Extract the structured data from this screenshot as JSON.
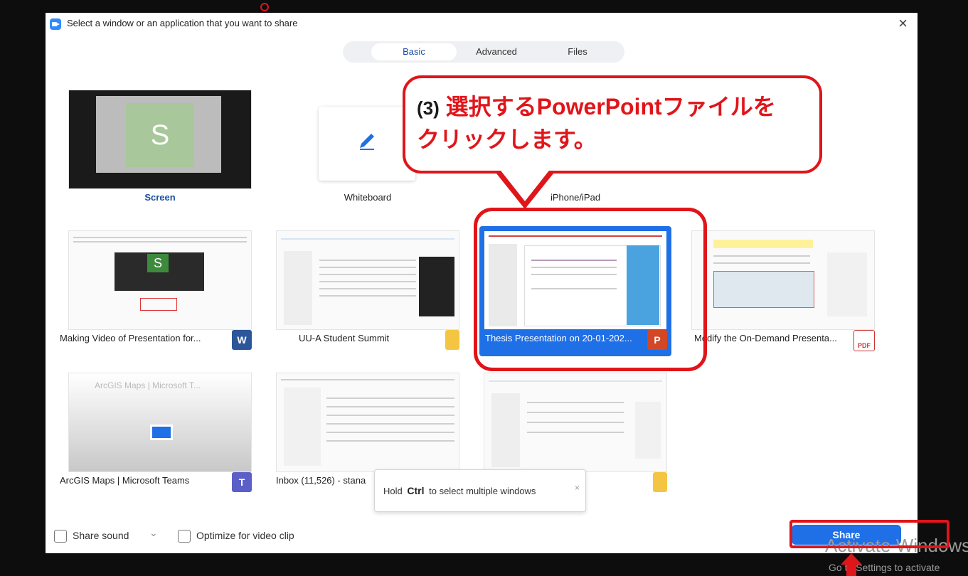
{
  "window": {
    "title": "Select a window or an application that you want to share"
  },
  "tabs": [
    {
      "label": "Basic",
      "active": true
    },
    {
      "label": "Advanced",
      "active": false
    },
    {
      "label": "Files",
      "active": false
    }
  ],
  "grid": [
    {
      "label": "Screen",
      "icon": "monitor-icon"
    },
    {
      "label": "Whiteboard",
      "icon": "pencil-icon"
    },
    {
      "label": "iPhone/iPad",
      "icon": "airplay-icon"
    },
    {
      "label": "Making Video of Presentation for...",
      "icon": "word-icon"
    },
    {
      "label": "UU-A Student Summit",
      "icon": "folder-icon"
    },
    {
      "label": "Thesis Presentation on 20-01-202...",
      "icon": "powerpoint-icon",
      "selected": true
    },
    {
      "label": "Modify the On-Demand Presenta...",
      "icon": "pdf-icon"
    },
    {
      "label": "ArcGIS Maps | Microsoft Teams",
      "icon": "teams-icon"
    },
    {
      "label": "Inbox (11,526) - stana",
      "icon": "mail-icon"
    },
    {
      "label": "",
      "icon": "folder-icon"
    }
  ],
  "thumb_text": {
    "screen_avatar": "S",
    "word_avatar": "S",
    "arcgis_title": "ArcGIS Maps | Microsoft T...",
    "word_badge": "W",
    "ppt_badge": "P",
    "pdf_badge": "PDF",
    "teams_badge": "T"
  },
  "annotation": {
    "step": "(3)",
    "text_line1": "選択するPowerPointファイルを",
    "text_line2": "クリックします。"
  },
  "tooltip": {
    "pre": "Hold",
    "key": "Ctrl",
    "post": "to select multiple windows",
    "close": "×"
  },
  "options": {
    "share_sound": "Share sound",
    "sound_chevron": "⌄",
    "optimize_video": "Optimize for video clip"
  },
  "share_button": "Share",
  "watermark": {
    "line1": "Activate Windows",
    "line2": "Go to Settings to activate"
  },
  "colors": {
    "accent": "#1f6fe6",
    "annotation_red": "#e0151a"
  }
}
